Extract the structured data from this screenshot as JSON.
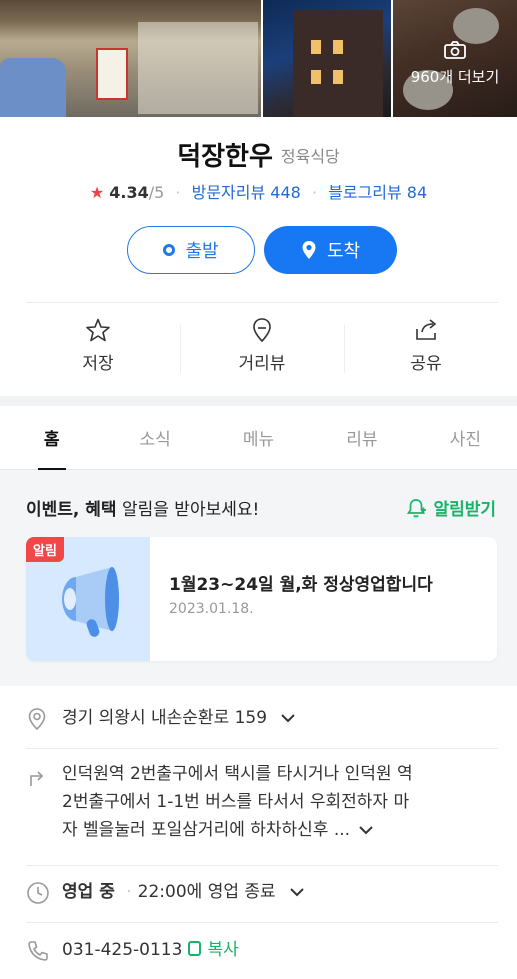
{
  "photos": {
    "more_label": "960개 더보기"
  },
  "place": {
    "name": "덕장한우",
    "category": "정육식당",
    "rating": "4.34",
    "rating_max": "/5",
    "visitor_reviews": "방문자리뷰 448",
    "blog_reviews": "블로그리뷰 84"
  },
  "route": {
    "start_label": "출발",
    "arrive_label": "도착"
  },
  "actions": [
    {
      "label": "저장",
      "icon": "star-icon"
    },
    {
      "label": "거리뷰",
      "icon": "map-pin-icon"
    },
    {
      "label": "공유",
      "icon": "share-icon"
    }
  ],
  "tabs": [
    "홈",
    "소식",
    "메뉴",
    "리뷰",
    "사진"
  ],
  "active_tab": "홈",
  "event": {
    "head_bold": "이벤트, 혜택",
    "head_rest": " 알림을 받아보세요!",
    "subscribe_label": "알림받기",
    "card": {
      "badge": "알림",
      "title": "1월23~24일 월,화 정상영업합니다",
      "date": "2023.01.18."
    }
  },
  "info": {
    "address": "경기 의왕시 내손순환로 159",
    "directions_line1": "인덕원역 2번출구에서 택시를 타시거나 인덕원 역",
    "directions_line2": "2번출구에서 1-1번 버스를 타서서 우회전하자 마",
    "directions_line3": "자 벨을눌러 포일삼거리에 하차하신후 ...",
    "hours_status": "영업 중",
    "hours_text": "22:00에 영업 종료",
    "phone": "031-425-0113",
    "copy_label": "복사"
  },
  "colors": {
    "accent_blue": "#1877f2",
    "link_blue": "#1f6bd6",
    "green": "#18b368",
    "red": "#f04343"
  }
}
